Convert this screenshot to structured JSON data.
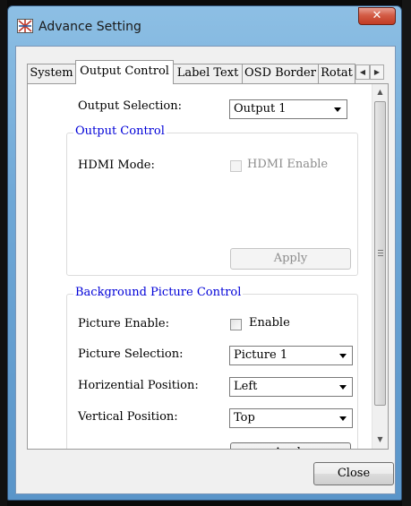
{
  "window": {
    "title": "Advance Setting",
    "close_glyph": "✕"
  },
  "tabs": [
    {
      "label": "System",
      "active": false
    },
    {
      "label": "Output Control",
      "active": true
    },
    {
      "label": "Label Text",
      "active": false
    },
    {
      "label": "OSD Border",
      "active": false
    },
    {
      "label": "Rotat",
      "active": false
    }
  ],
  "tab_scroll": {
    "left": "◀",
    "right": "▶"
  },
  "output_selection": {
    "label": "Output Selection:",
    "value": "Output 1"
  },
  "output_control_group": {
    "title": "Output Control",
    "hdmi_mode_label": "HDMI Mode:",
    "hdmi_enable_label": "HDMI Enable",
    "hdmi_enable_checked": false,
    "apply_label": "Apply"
  },
  "background_group": {
    "title": "Background Picture Control",
    "picture_enable_label": "Picture Enable:",
    "enable_label": "Enable",
    "enable_checked": false,
    "picture_selection_label": "Picture Selection:",
    "picture_selection_value": "Picture 1",
    "horizontal_position_label": "Horizential Position:",
    "horizontal_position_value": "Left",
    "vertical_position_label": "Vertical Position:",
    "vertical_position_value": "Top",
    "apply_label": "Apply"
  },
  "scrollbar": {
    "up": "▲",
    "down": "▼"
  },
  "close_button": "Close",
  "colors": {
    "group_title": "#0000d8",
    "titlebar": "#6ea7d6",
    "close_red": "#c13c25"
  },
  "icons": [
    "app-icon",
    "close-icon",
    "scroll-left-icon",
    "scroll-right-icon",
    "scroll-up-icon",
    "scroll-down-icon",
    "dropdown-arrow-icon"
  ]
}
